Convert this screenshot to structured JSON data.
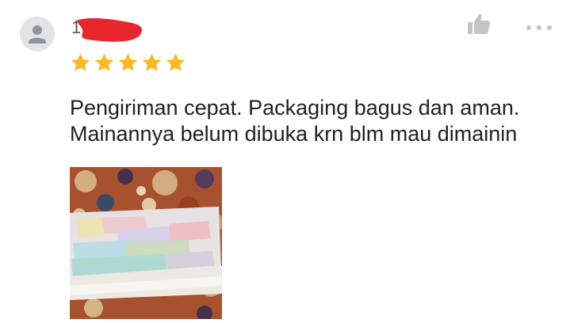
{
  "review": {
    "username_visible": "1",
    "rating": 5,
    "rating_max": 5,
    "text": "Pengiriman cepat. Packaging bagus dan aman. Mainannya belum dibuka krn blm mau dimainin"
  },
  "icons": {
    "avatar": "person-icon",
    "like": "thumbs-up-icon",
    "more": "more-dots-icon",
    "star": "star-icon"
  },
  "colors": {
    "star": "#f9b826",
    "icon_gray": "#c4c4c4",
    "redaction": "#e8262d",
    "avatar_bg": "#e1e3e6"
  }
}
